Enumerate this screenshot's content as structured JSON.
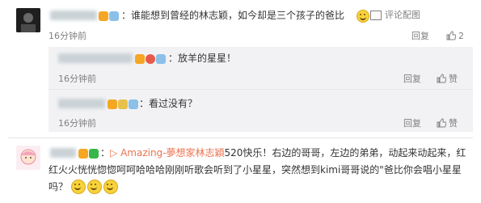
{
  "comment1": {
    "text": "：谁能想到曾经的林志颖，如今却是三个孩子的爸比",
    "time": "16分钟前",
    "link": "评论配图",
    "reply": "回复",
    "colors": {
      "name": "#eb7350",
      "meta": "#808080"
    }
  },
  "reply1": {
    "text": "：放羊的星星！",
    "time": "16分钟前",
    "reply": "回复",
    "like": "赞"
  },
  "reply2": {
    "text": "：看过没有？",
    "time": "16分钟前",
    "reply": "回复",
    "like": "赞"
  },
  "comment2": {
    "line1_prefix": "：",
    "line1_link": "Amazing-夢想家林志穎",
    "line1_rest": "520快乐！右边的哥哥，左边的弟弟，动起来动起来，红",
    "line2": "红火火恍恍惚惚呵呵哈哈哈刚刚听歌会听到了小星星，突然想到kimi哥哥说的\"爸比你会唱小星星",
    "line3": "吗？"
  }
}
